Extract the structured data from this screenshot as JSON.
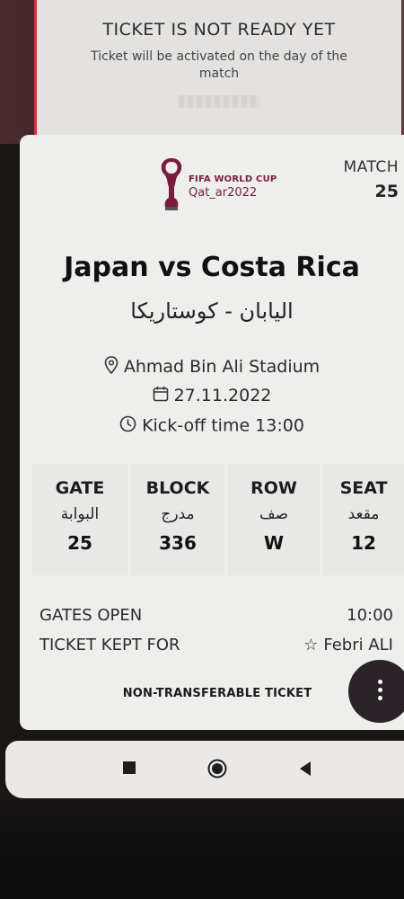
{
  "previous_ticket": {
    "title": "TICKET IS NOT READY YET",
    "subtitle": "Ticket will be activated on the day of the match"
  },
  "ticket": {
    "logo_line1": "FIFA WORLD CUP",
    "logo_line2": "Qat_ar2022",
    "match_label": "MATCH",
    "match_number": "25",
    "teams": "Japan vs Costa Rica",
    "teams_arabic": "اليابان - كوستاريكا",
    "stadium": "Ahmad Bin Ali Stadium",
    "date": "27.11.2022",
    "kickoff": "Kick-off time 13:00",
    "seating": [
      {
        "label": "GATE",
        "label_ar": "البوابة",
        "value": "25"
      },
      {
        "label": "BLOCK",
        "label_ar": "مدرج",
        "value": "336"
      },
      {
        "label": "ROW",
        "label_ar": "صف",
        "value": "W"
      },
      {
        "label": "SEAT",
        "label_ar": "مقعد",
        "value": "12"
      }
    ],
    "gates_open_label": "GATES OPEN",
    "gates_open_time": "10:00",
    "kept_for_label": "TICKET KEPT FOR",
    "kept_for_name": "Febri ALI",
    "non_transferable": "NON-TRANSFERABLE TICKET"
  },
  "icons": {
    "location": "map-pin-icon",
    "date": "calendar-icon",
    "time": "clock-icon",
    "star": "star-icon",
    "menu": "more-vert-icon"
  },
  "colors": {
    "accent_red": "#c23a3a",
    "qatar_maroon": "#7a1d3c",
    "fab": "#2a2327"
  }
}
